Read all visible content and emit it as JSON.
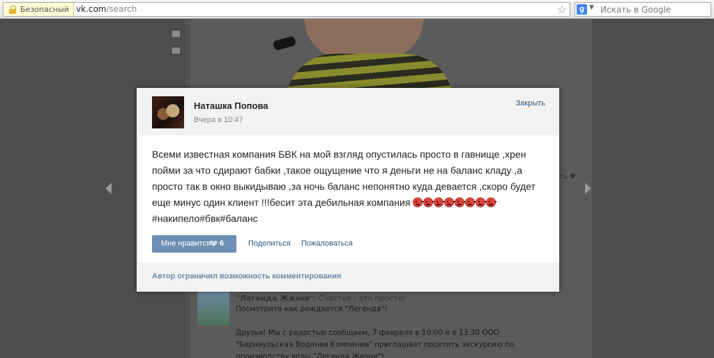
{
  "browser": {
    "security_label": "Безопасный",
    "url_host": "vk.com",
    "url_path": "/search",
    "search_placeholder": "Искать в Google",
    "search_engine_icon": "google-icon"
  },
  "background_page": {
    "side_text": "зать",
    "post_title": "\"Легенда Жизни\"",
    "post_title_rest": ": Счастье - это просто!",
    "lines": [
      "Посмотрите как рождается \"Легенда\"!",
      "",
      "Друзья! Мы с радостью сообщаем, 7 февраля в 10:00 и в 13:30 ООО",
      "\"Барнаульская Водяная Компания\" приглашает посетить экскурсию по",
      "производству воды \"Легенда Жизни\"!"
    ]
  },
  "post": {
    "author": "Наташка Попова",
    "date": "Вчера в 10:47",
    "close_label": "Закрыть",
    "text": "Всеми известная компания БВК на мой взгляд опустилась просто в гавнище ,хрен пойми за что сдирают бабки ,такое ощущение что я деньги не на баланс кладу ,а просто так в окно выкидываю ,за ночь баланс непонятно куда девается ,скоро будет еще минус один клиент !!!бесит эта дебильная компания",
    "emoji_count": 8,
    "hashtags": "#накипело#бвк#баланс",
    "like_label": "Мне нравится",
    "like_count": "6",
    "share_label": "Поделиться",
    "report_label": "Пожаловаться",
    "footer_text": "Автор ограничил возможность комментирования"
  },
  "colors": {
    "overlay": "#4d4d4d",
    "link": "#2b587a",
    "like_button": "#6d8fb3",
    "footer_text": "#6c8cac",
    "emoji_angry": "#e2463a"
  }
}
